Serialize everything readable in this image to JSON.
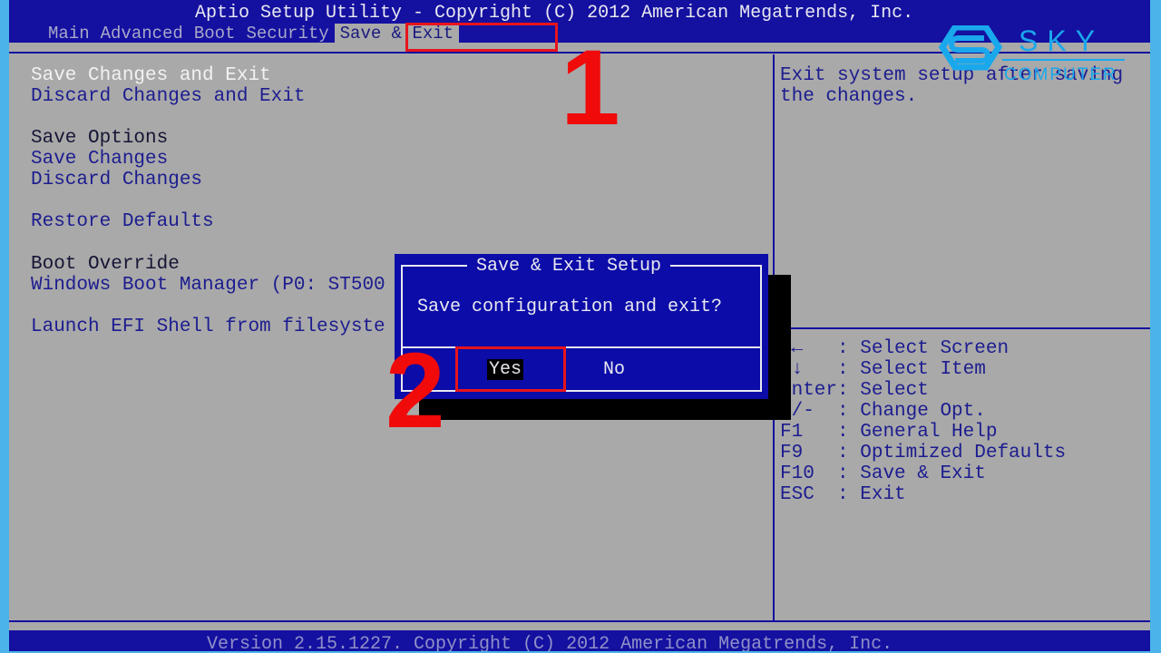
{
  "header": {
    "title": "Aptio Setup Utility - Copyright (C) 2012 American Megatrends, Inc.",
    "tabs": [
      {
        "label": "Main"
      },
      {
        "label": "Advanced"
      },
      {
        "label": "Boot"
      },
      {
        "label": "Security"
      },
      {
        "label": "Save & Exit",
        "active": true
      }
    ]
  },
  "menu": {
    "save_changes_exit": "Save Changes and Exit",
    "discard_changes_exit": "Discard Changes and Exit",
    "save_options_heading": "Save Options",
    "save_changes": "Save Changes",
    "discard_changes": "Discard Changes",
    "restore_defaults": "Restore Defaults",
    "boot_override_heading": "Boot Override",
    "windows_boot_manager": "Windows Boot Manager (P0: ST500",
    "launch_efi_shell": "Launch EFI Shell from filesyste"
  },
  "help": {
    "description": "Exit system setup after saving\nthe changes."
  },
  "keys": [
    {
      "key": "→←   ",
      "action": "Select Screen"
    },
    {
      "key": "↑↓   ",
      "action": "Select Item"
    },
    {
      "key": "Enter",
      "action": "Select"
    },
    {
      "key": "+/-  ",
      "action": "Change Opt."
    },
    {
      "key": "F1   ",
      "action": "General Help"
    },
    {
      "key": "F9   ",
      "action": "Optimized Defaults"
    },
    {
      "key": "F10  ",
      "action": "Save & Exit"
    },
    {
      "key": "ESC  ",
      "action": "Exit"
    }
  ],
  "dialog": {
    "title": "Save & Exit Setup",
    "message": "Save configuration and exit?",
    "yes": "Yes",
    "no": "No",
    "selected": "Yes"
  },
  "footer": {
    "text": "Version 2.15.1227. Copyright (C) 2012 American Megatrends, Inc."
  },
  "annotations": {
    "step1": "1",
    "step2": "2",
    "highlight_color": "#e8141c"
  },
  "watermark": {
    "brand": "SKY",
    "sub": "COMPUTER"
  },
  "colors": {
    "bios_blue": "#1410a0",
    "bios_gray": "#a9a9a9",
    "frame": "#4bb3ea"
  }
}
